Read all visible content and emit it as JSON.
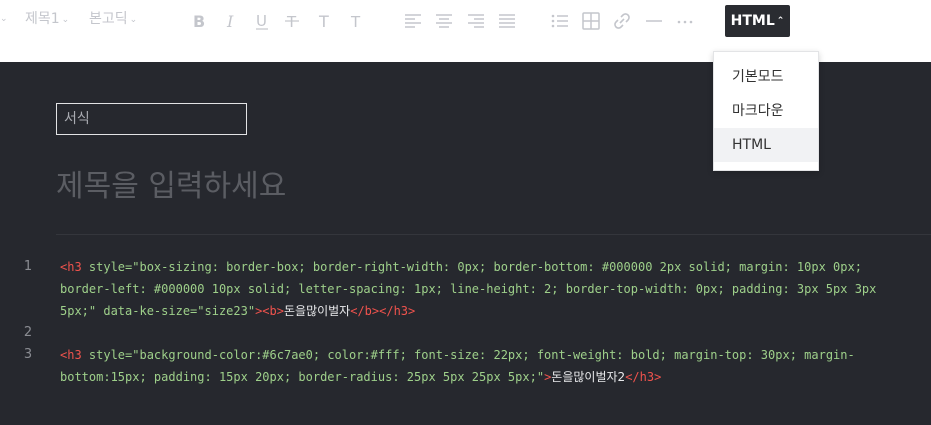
{
  "toolbar": {
    "block_style_label": "제목1",
    "font_label": "본고딕",
    "mode_button_label": "HTML"
  },
  "mode_menu": {
    "items": [
      "기본모드",
      "마크다운",
      "HTML"
    ],
    "selected": "HTML"
  },
  "editor": {
    "category_value": "서식",
    "title_placeholder": "제목을 입력하세요",
    "line_numbers": [
      "1",
      "2",
      "3"
    ],
    "lines": {
      "l1a": {
        "tag_open": "<h3 ",
        "attrs": "style=\"box-sizing: border-box; border-right-width: 0px; border-bottom: #000000 2px solid; margin: 10px 0px;"
      },
      "l1b": {
        "attrs": "border-left: #000000 10px solid; letter-spacing: 1px; line-height: 2; border-top-width: 0px; padding: 3px 5px 3px"
      },
      "l1c": {
        "attrs": "5px;\" data-ke-size=\"size23\"",
        "tag_mid": "><b>",
        "text": "돈을많이벌자",
        "tag_close": "</b></h3>"
      },
      "l3a": {
        "tag_open": "<h3 ",
        "attrs": "style=\"background-color:#6c7ae0; color:#fff; font-size: 22px; font-weight: bold; margin-top: 30px; margin-"
      },
      "l3b": {
        "attrs": "bottom:15px; padding: 15px 20px; border-radius: 25px 5px 25px 5px;\"",
        "tag_mid": ">",
        "text": "돈을많이벌자2",
        "tag_close": "</h3>"
      }
    }
  },
  "colors": {
    "editor_bg": "#26282e",
    "tag": "#f0534d",
    "attribute": "#9ed08a",
    "text": "#e9eaec",
    "mode_button_bg": "#2a2c31"
  }
}
